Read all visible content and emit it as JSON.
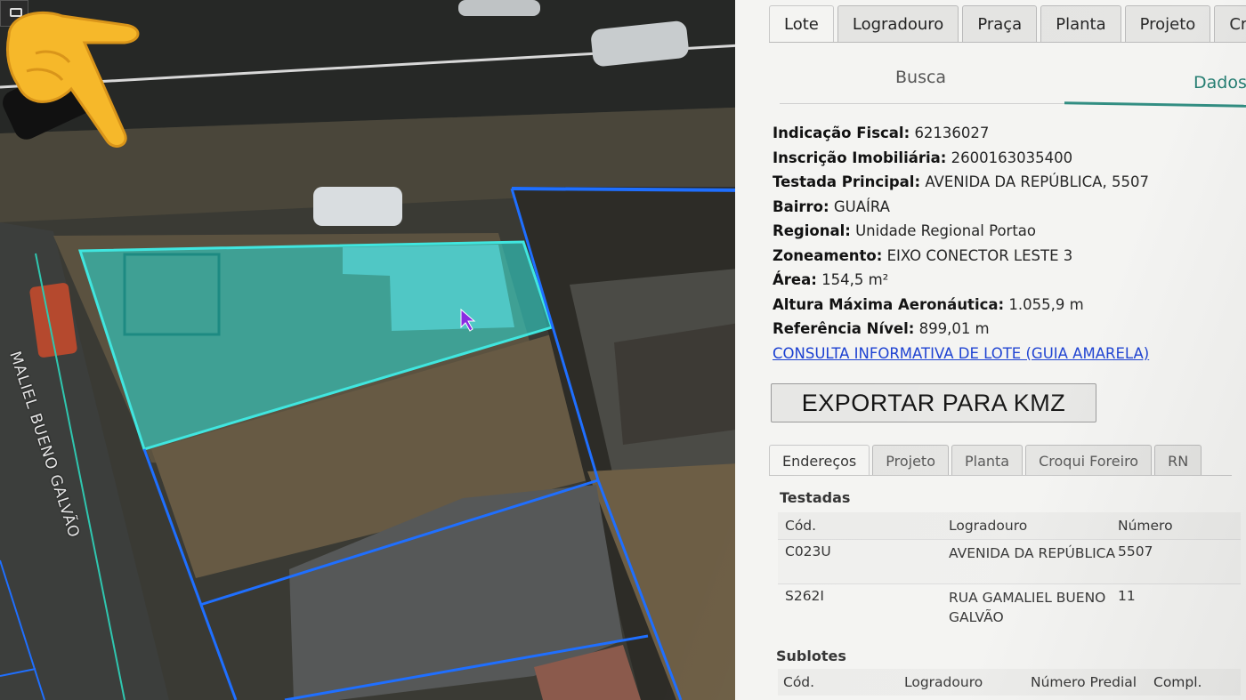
{
  "map": {
    "street_label": "MALIEL BUENO GALVÃO",
    "pointer_emoji": "pointing-hand-icon"
  },
  "tabs_top": [
    "Lote",
    "Logradouro",
    "Praça",
    "Planta",
    "Projeto",
    "Cro"
  ],
  "subnav": {
    "busca": "Busca",
    "dados": "Dados"
  },
  "info": {
    "indicacao_label": "Indicação Fiscal:",
    "indicacao_value": "62136027",
    "inscricao_label": "Inscrição Imobiliária:",
    "inscricao_value": "2600163035400",
    "testada_label": "Testada Principal:",
    "testada_value": "AVENIDA DA REPÚBLICA, 5507",
    "bairro_label": "Bairro:",
    "bairro_value": "GUAÍRA",
    "regional_label": "Regional:",
    "regional_value": "Unidade Regional Portao",
    "zoneamento_label": "Zoneamento:",
    "zoneamento_value": "EIXO CONECTOR LESTE 3",
    "area_label": "Área:",
    "area_value": "154,5 m²",
    "altura_label": "Altura Máxima Aeronáutica:",
    "altura_value": "1.055,9 m",
    "referencia_label": "Referência Nível:",
    "referencia_value": "899,01 m",
    "consulta_link": "CONSULTA INFORMATIVA DE LOTE (GUIA AMARELA)"
  },
  "export_button": "EXPORTAR PARA KMZ",
  "tabs_bottom": [
    "Endereços",
    "Projeto",
    "Planta",
    "Croqui Foreiro",
    "RN"
  ],
  "testadas": {
    "title": "Testadas",
    "headers": [
      "Cód.",
      "Logradouro",
      "Número"
    ],
    "rows": [
      {
        "cod": "C023U",
        "logradouro": "AVENIDA DA REPÚBLICA",
        "numero": "5507"
      },
      {
        "cod": "S262I",
        "logradouro": "RUA GAMALIEL BUENO GALVÃO",
        "numero": "11"
      }
    ]
  },
  "sublotes": {
    "title": "Sublotes",
    "headers": [
      "Cód.",
      "Logradouro",
      "Número Predial",
      "Compl."
    ]
  }
}
